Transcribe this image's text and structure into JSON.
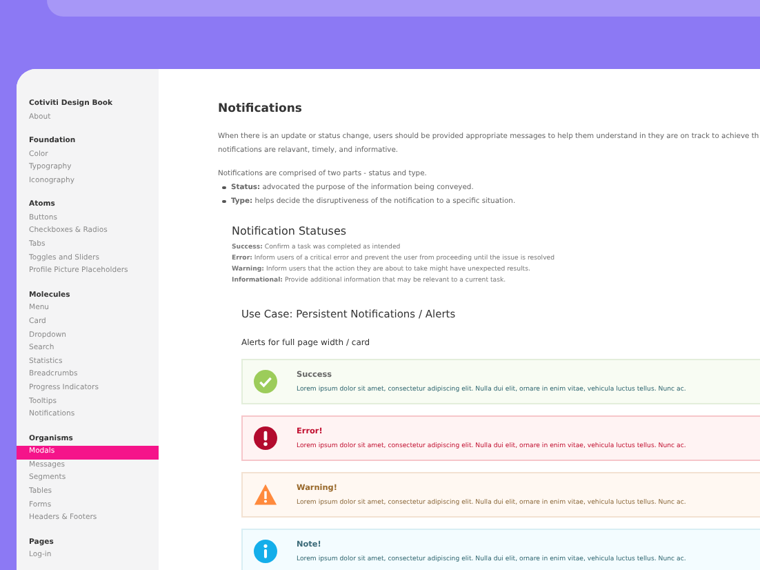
{
  "sidebar": {
    "title": "Cotiviti Design Book",
    "sections": [
      {
        "items": [
          {
            "label": "About",
            "selected": false
          }
        ]
      },
      {
        "heading": "Foundation",
        "items": [
          {
            "label": "Color",
            "selected": false
          },
          {
            "label": "Typography",
            "selected": false
          },
          {
            "label": "Iconography",
            "selected": false
          }
        ]
      },
      {
        "heading": "Atoms",
        "items": [
          {
            "label": "Buttons",
            "selected": false
          },
          {
            "label": "Checkboxes & Radios",
            "selected": false
          },
          {
            "label": "Tabs",
            "selected": false
          },
          {
            "label": "Toggles and Sliders",
            "selected": false
          },
          {
            "label": "Profile Picture Placeholders",
            "selected": false
          }
        ]
      },
      {
        "heading": "Molecules",
        "items": [
          {
            "label": "Menu",
            "selected": false
          },
          {
            "label": "Card",
            "selected": false
          },
          {
            "label": "Dropdown",
            "selected": false
          },
          {
            "label": "Search",
            "selected": false
          },
          {
            "label": "Statistics",
            "selected": false
          },
          {
            "label": "Breadcrumbs",
            "selected": false
          },
          {
            "label": "Progress Indicators",
            "selected": false
          },
          {
            "label": "Tooltips",
            "selected": false
          },
          {
            "label": "Notifications",
            "selected": false
          }
        ]
      },
      {
        "heading": "Organisms",
        "items": [
          {
            "label": "Modals",
            "selected": true
          },
          {
            "label": "Messages",
            "selected": false
          },
          {
            "label": "Segments",
            "selected": false
          },
          {
            "label": "Tables",
            "selected": false
          },
          {
            "label": "Forms",
            "selected": false
          },
          {
            "label": "Headers & Footers",
            "selected": false
          }
        ]
      },
      {
        "heading": "Pages",
        "items": [
          {
            "label": "Log-in",
            "selected": false
          }
        ]
      }
    ]
  },
  "content": {
    "title": "Notifications",
    "intro_lines": [
      "When there is an update or status change, users should be provided appropriate messages to help them understand in they are on track to achieve th",
      "notifications are relavant, timely, and informative."
    ],
    "parts_intro": "Notifications are comprised of two parts - status and type.",
    "bullets": [
      "**Status:** advocated the purpose of the information being conveyed.",
      "**Type:** helps decide the disruptiveness of the notification to a specific situation."
    ],
    "statuses_title": "Notification Statuses",
    "statuses": [
      "**Success:** Confirm a task was completed as intended",
      "**Error:** Inform users of a critical error and prevent the user from proceeding until the issue is resolved",
      "**Warning:** Inform users that the action they are about to take might have unexpected results.",
      "**Informational:** Provide additional information that may be relevant to a current task."
    ],
    "use_case_title": "Use Case: Persistent Notifications / Alerts",
    "alerts_subtitle": "Alerts for full page width / card",
    "alerts": [
      {
        "kind": "success",
        "title": "Success",
        "text": "Lorem ipsum dolor sit amet, consectetur adipiscing elit. Nulla dui elit, ornare in enim vitae, vehicula luctus tellus. Nunc ac."
      },
      {
        "kind": "error",
        "title": "Error!",
        "text": "Lorem ipsum dolor sit amet, consectetur adipiscing elit. Nulla dui elit, ornare in enim vitae, vehicula luctus tellus. Nunc ac."
      },
      {
        "kind": "warning",
        "title": "Warning!",
        "text": "Lorem ipsum dolor sit amet, consectetur adipiscing elit. Nulla dui elit, ornare in enim vitae, vehicula luctus tellus. Nunc ac."
      },
      {
        "kind": "note",
        "title": "Note!",
        "text": "Lorem ipsum dolor sit amet, consectetur adipiscing elit. Nulla dui elit, ornare in enim vitae, vehicula luctus tellus. Nunc ac."
      }
    ]
  }
}
